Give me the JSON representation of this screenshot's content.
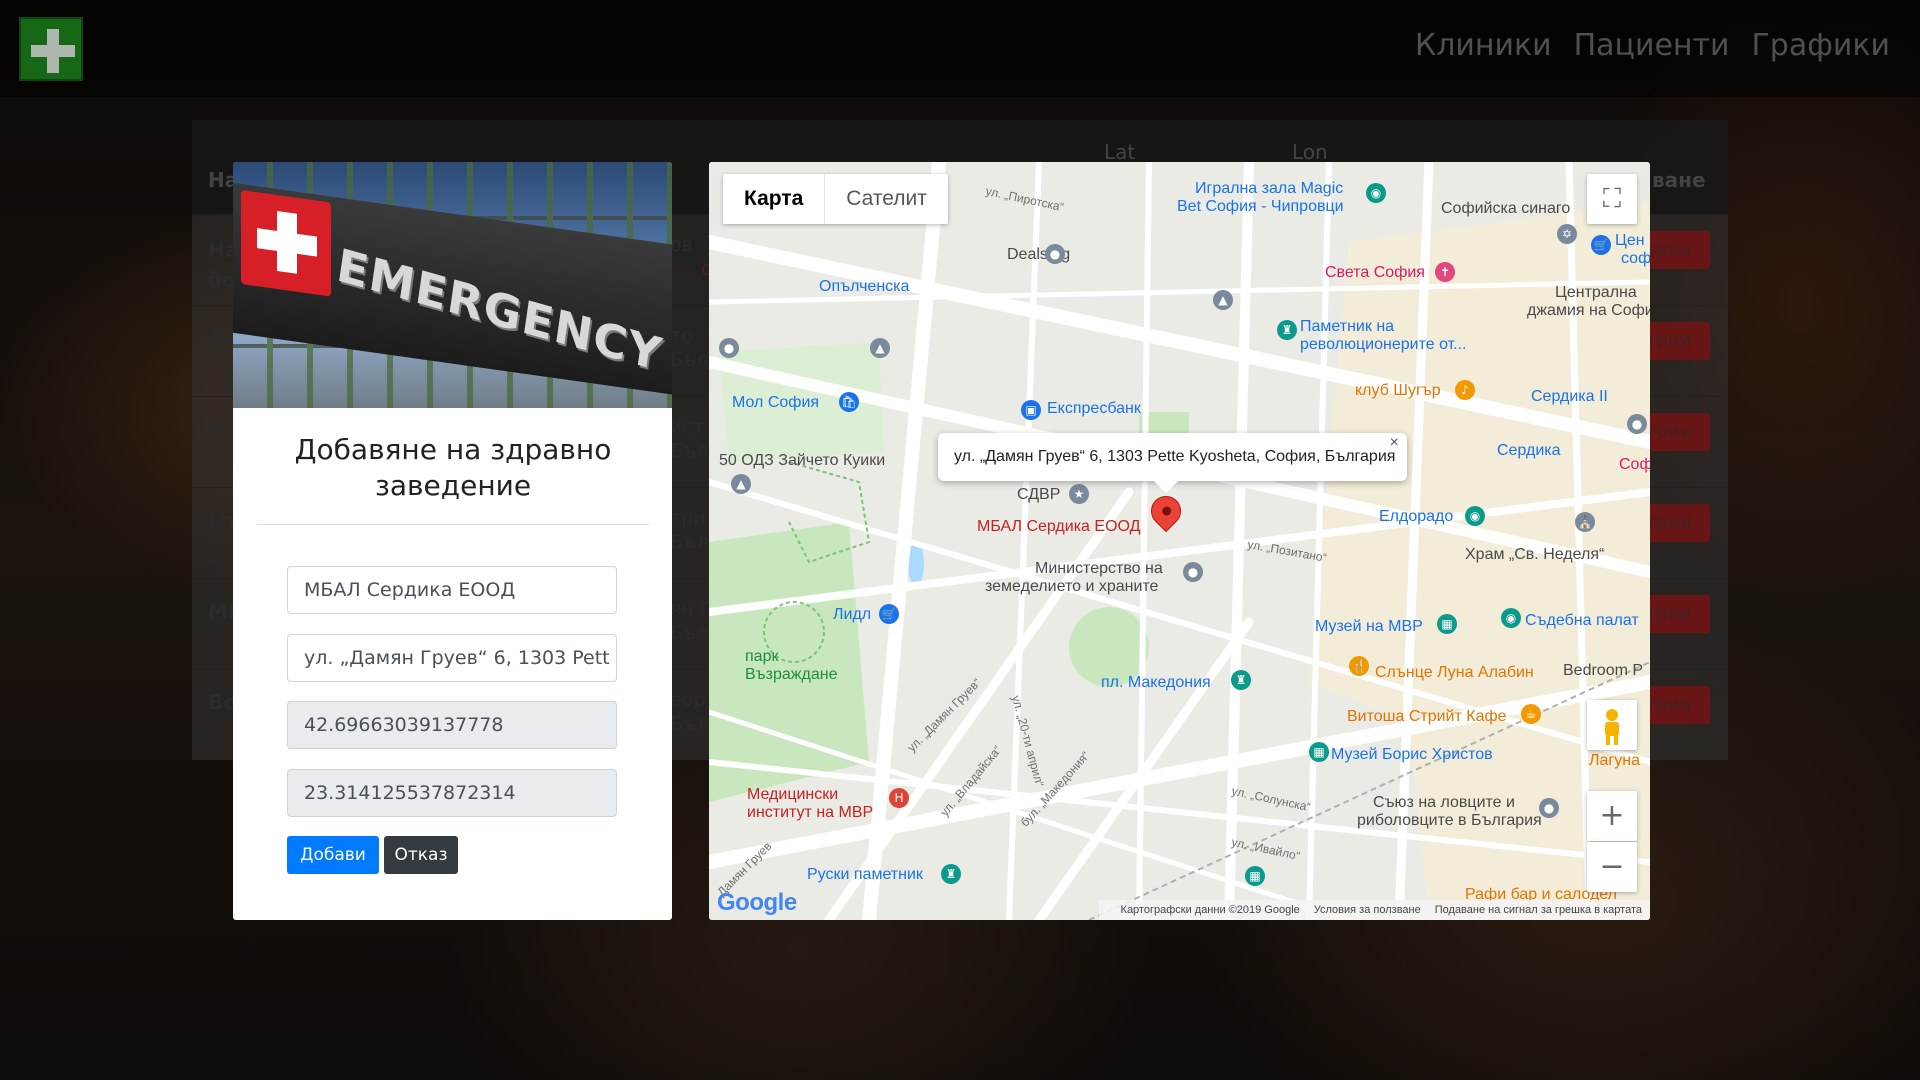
{
  "nav": {
    "links": [
      "Клиники",
      "Пациенти",
      "Графики"
    ]
  },
  "table": {
    "headers": [
      "На",
      "Lat",
      "Lon",
      "ване"
    ],
    "rows": [
      {
        "name": "На\nбо",
        "mid": "ов\n",
        "action": "трии",
        "mark": "од"
      },
      {
        "name": "ДН",
        "mid": "то\nБъл",
        "action": "трии"
      },
      {
        "name": "Вт",
        "mid": "ист\nБъл",
        "action": "трии"
      },
      {
        "name": "Пъ",
        "mid": "три\nБъл",
        "action": "трии"
      },
      {
        "name": "МІ",
        "mid": "ян Г\nБъл",
        "action": "трии"
      },
      {
        "name": "Во",
        "mid": "еор\nБъл",
        "action": "трии"
      }
    ]
  },
  "form": {
    "hero_text": "EMERGENCY",
    "title": "Добавяне на здравно заведение",
    "name_value": "МБАЛ Сердика ЕООД",
    "address_value": "ул. „Дамян Груев“ 6, 1303 Pett",
    "lat_value": "42.69663039137778",
    "lon_value": "23.314125537872314",
    "submit_label": "Добави",
    "cancel_label": "Отказ"
  },
  "map": {
    "tabs": [
      "Карта",
      "Сателит"
    ],
    "active_tab": "Карта",
    "infowindow": "ул. „Дамян Груев“ 6, 1303 Pette Kyosheta, София, България",
    "infowindow_close": "×",
    "fullscreen_icon": "⛶",
    "zoom_in": "+",
    "zoom_out": "−",
    "google_logo": "Google",
    "attribution": {
      "data": "Картографски данни ©2019 Google",
      "terms": "Условия за ползване",
      "report": "Подаване на сигнал за грешка в картата"
    },
    "places": [
      {
        "text": "ул. „Пиротска“",
        "cls": "street"
      },
      {
        "text": "Игрална зала Magic",
        "cls": "lbl-blue"
      },
      {
        "text": "Bet София - Чипровци",
        "cls": "lbl-blue"
      },
      {
        "text": "Софийска синаго",
        "cls": "lbl-dark"
      },
      {
        "text": "Цен",
        "cls": "lbl-blue"
      },
      {
        "text": "соф",
        "cls": "lbl-blue"
      },
      {
        "text": "Deals.bg",
        "cls": "lbl-dark"
      },
      {
        "text": "Света София",
        "cls": "lbl-pink"
      },
      {
        "text": "Опълченска",
        "cls": "lbl-blue"
      },
      {
        "text": "Централна",
        "cls": "lbl-dark"
      },
      {
        "text": "джамия на София",
        "cls": "lbl-dark"
      },
      {
        "text": "Паметник на",
        "cls": "lbl-blue"
      },
      {
        "text": "революционерите от...",
        "cls": "lbl-blue"
      },
      {
        "text": "Мол София",
        "cls": "lbl-blue"
      },
      {
        "text": "Експресбанк",
        "cls": "lbl-blue"
      },
      {
        "text": "клуб Шугър",
        "cls": "lbl-orange"
      },
      {
        "text": "Сердика II",
        "cls": "lbl-blue"
      },
      {
        "text": "50 ОДЗ Зайчето Куики",
        "cls": "lbl-dark"
      },
      {
        "text": "Сердика",
        "cls": "lbl-blue"
      },
      {
        "text": "Соф",
        "cls": "lbl-pink"
      },
      {
        "text": "СДВР",
        "cls": "lbl-dark"
      },
      {
        "text": "МБАЛ Сердика ЕООД",
        "cls": "lbl-red"
      },
      {
        "text": "Елдорадо",
        "cls": "lbl-blue"
      },
      {
        "text": "ул. „Позитано“",
        "cls": "street"
      },
      {
        "text": "Храм „Св. Неделя“",
        "cls": "lbl-dark"
      },
      {
        "text": "Министерство на",
        "cls": "lbl-dark"
      },
      {
        "text": "земеделието и храните",
        "cls": "lbl-dark"
      },
      {
        "text": "Лидл",
        "cls": "lbl-blue"
      },
      {
        "text": "Музей на МВР",
        "cls": "lbl-blue"
      },
      {
        "text": "Съдебна палат",
        "cls": "lbl-blue"
      },
      {
        "text": "парк",
        "cls": "lbl-green"
      },
      {
        "text": "Възраждане",
        "cls": "lbl-green"
      },
      {
        "text": "Слънце Луна Алабин",
        "cls": "lbl-orange"
      },
      {
        "text": "Bedroom P",
        "cls": "lbl-dark"
      },
      {
        "text": "пл. Македония",
        "cls": "lbl-blue"
      },
      {
        "text": "Витоша Стрийт Кафе",
        "cls": "lbl-orange"
      },
      {
        "text": "ул. „Дамян Груев“",
        "cls": "street"
      },
      {
        "text": "ул. „20-ти април“",
        "cls": "street"
      },
      {
        "text": "Музей Борис Христов",
        "cls": "lbl-blue"
      },
      {
        "text": "Лагуна",
        "cls": "lbl-orange"
      },
      {
        "text": "ул. „Владайска“",
        "cls": "street"
      },
      {
        "text": "бул. „Македония“",
        "cls": "street"
      },
      {
        "text": "Медицински",
        "cls": "lbl-red"
      },
      {
        "text": "институт на МВР",
        "cls": "lbl-red"
      },
      {
        "text": "ул. „Солунска“",
        "cls": "street"
      },
      {
        "text": "Съюз на ловците и",
        "cls": "lbl-dark"
      },
      {
        "text": "риболовците в България",
        "cls": "lbl-dark"
      },
      {
        "text": "ул. „Ивайло“",
        "cls": "street"
      },
      {
        "text": "Руски паметник",
        "cls": "lbl-blue"
      },
      {
        "text": "Рафи бар и салодел",
        "cls": "lbl-orange"
      },
      {
        "text": "Дамян Груев",
        "cls": "street"
      }
    ]
  }
}
